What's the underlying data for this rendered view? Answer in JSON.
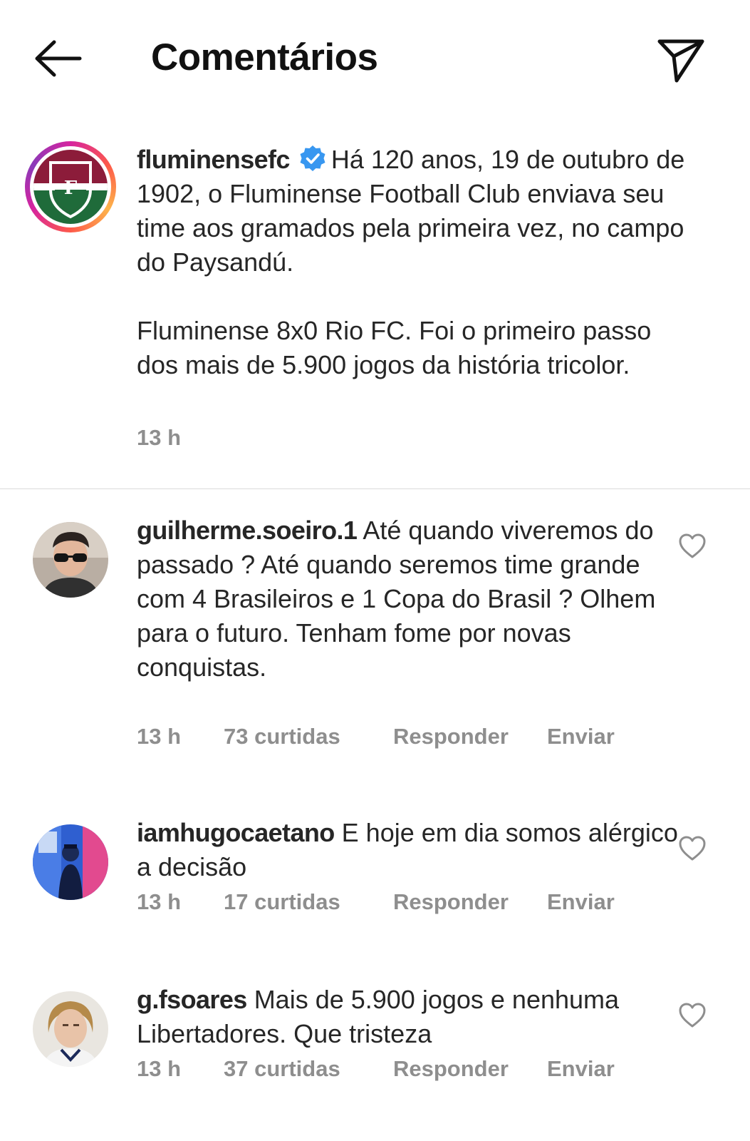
{
  "header": {
    "title": "Comentários"
  },
  "caption": {
    "username": "fluminensefc",
    "text_part1": "Há 120 anos, 19 de outubro de 1902, o Fluminense Football Club enviava seu time aos gramados pela primeira vez, no campo do Paysandú.",
    "text_part2": "Fluminense 8x0 Rio FC. Foi o primeiro passo dos mais de 5.900 jogos da história tricolor.",
    "time": "13 h"
  },
  "comments": [
    {
      "username": "guilherme.soeiro.1",
      "text": "Até quando viveremos do passado ? Até quando seremos time grande com 4 Brasileiros e 1 Copa do Brasil ? Olhem para o futuro. Tenham fome por novas conquistas.",
      "time": "13 h",
      "likes": "73 curtidas",
      "reply_label": "Responder",
      "send_label": "Enviar"
    },
    {
      "username": "iamhugocaetano",
      "text": "E hoje em dia somos alérgico a decisão",
      "time": "13 h",
      "likes": "17 curtidas",
      "reply_label": "Responder",
      "send_label": "Enviar"
    },
    {
      "username": "g.fsoares",
      "text": "Mais de 5.900 jogos e nenhuma Libertadores. Que tristeza",
      "time": "13 h",
      "likes": "37 curtidas",
      "reply_label": "Responder",
      "send_label": "Enviar"
    }
  ],
  "colors": {
    "text": "#262626",
    "meta": "#8e8e8e",
    "verified": "#3897f0",
    "divider": "#dbdbdb"
  },
  "icons": {
    "back": "arrow-left-icon",
    "send": "paper-plane-icon",
    "verified": "verified-badge-icon",
    "like": "heart-icon"
  }
}
